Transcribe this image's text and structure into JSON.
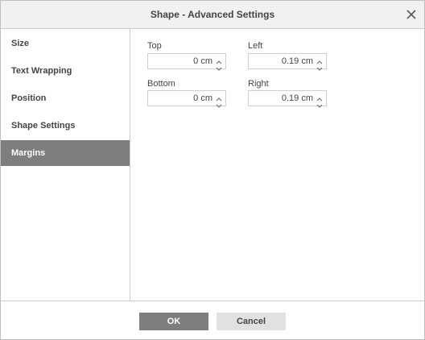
{
  "window": {
    "title": "Shape - Advanced Settings"
  },
  "sidebar": {
    "items": [
      {
        "label": "Size"
      },
      {
        "label": "Text Wrapping"
      },
      {
        "label": "Position"
      },
      {
        "label": "Shape Settings"
      },
      {
        "label": "Margins"
      }
    ],
    "active": "Margins"
  },
  "margins": {
    "top": {
      "label": "Top",
      "value": "0 cm"
    },
    "left": {
      "label": "Left",
      "value": "0.19 cm"
    },
    "bottom": {
      "label": "Bottom",
      "value": "0 cm"
    },
    "right": {
      "label": "Right",
      "value": "0.19 cm"
    }
  },
  "footer": {
    "ok_label": "OK",
    "cancel_label": "Cancel"
  },
  "icons": {
    "close": "close-icon",
    "up": "chevron-up-icon",
    "down": "chevron-down-icon"
  },
  "colors": {
    "active_bg": "#7e7e7e",
    "header_bg": "#f1f1f1",
    "cancel_bg": "#e1e1e1"
  }
}
